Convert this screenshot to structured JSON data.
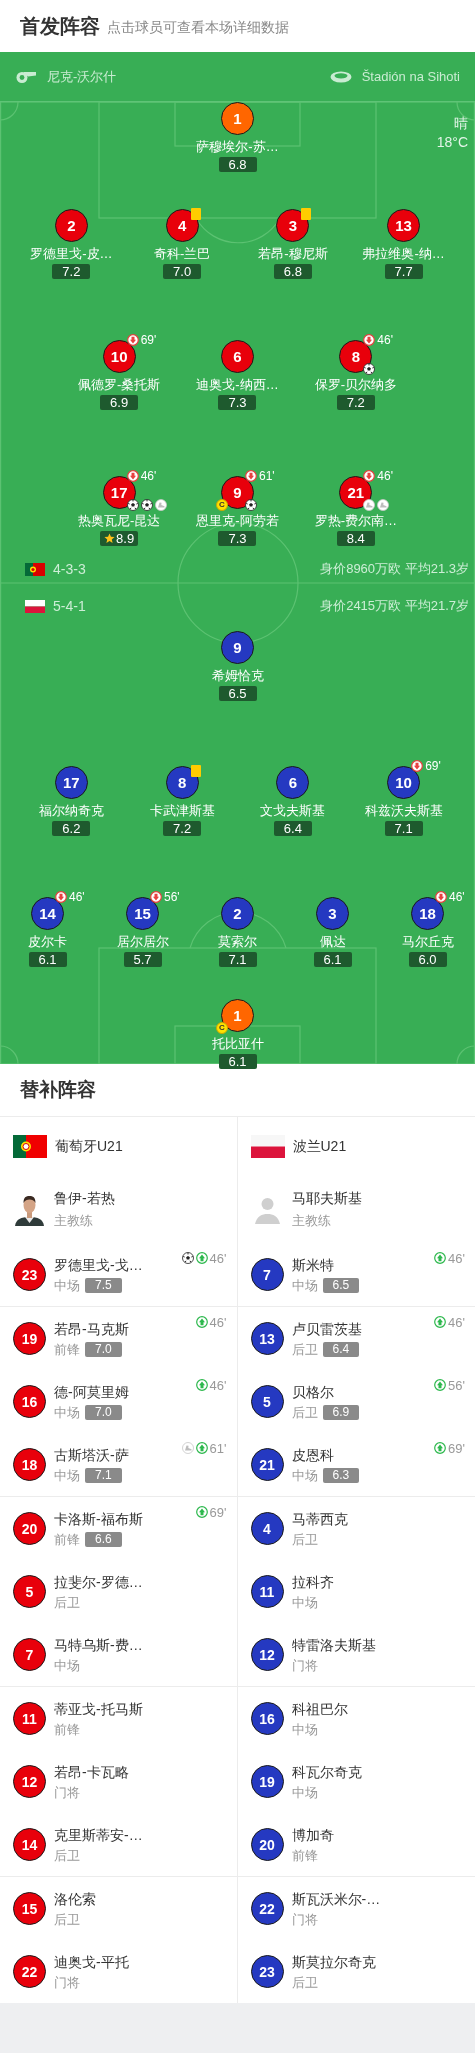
{
  "header": {
    "title": "首发阵容",
    "subtitle": "点击球员可查看本场详细数据"
  },
  "pitch": {
    "referee": "尼克-沃尔什",
    "stadium": "Štadión na Sihoti",
    "weather": "晴",
    "temperature": "18°C",
    "home": {
      "flag": {
        "kind": "portugal"
      },
      "formation": "4-3-3",
      "value_info": "身价8960万欧 平均21.3岁",
      "rows": [
        {
          "players": [
            {
              "number": "1",
              "name": "萨穆埃尔-苏…",
              "rating": "6.8",
              "color": "#ff6600",
              "yellow_card": false,
              "top_rated": false
            }
          ]
        },
        {
          "players": [
            {
              "number": "2",
              "name": "罗德里戈-皮…",
              "rating": "7.2",
              "color": "#e8000b",
              "yellow_card": false,
              "top_rated": false
            },
            {
              "number": "4",
              "name": "奇科-兰巴",
              "rating": "7.0",
              "color": "#e8000b",
              "yellow_card": true,
              "top_rated": false
            },
            {
              "number": "3",
              "name": "若昂-穆尼斯",
              "rating": "6.8",
              "color": "#e8000b",
              "yellow_card": true,
              "top_rated": false
            },
            {
              "number": "13",
              "name": "弗拉维奥-纳…",
              "rating": "7.7",
              "color": "#e8000b",
              "yellow_card": false,
              "top_rated": false
            }
          ]
        },
        {
          "players": [
            {
              "number": "10",
              "name": "佩德罗-桑托斯",
              "rating": "6.9",
              "color": "#e8000b",
              "yellow_card": false,
              "top_rated": false,
              "sub_out": "69'"
            },
            {
              "number": "6",
              "name": "迪奥戈-纳西…",
              "rating": "7.3",
              "color": "#e8000b",
              "yellow_card": false,
              "top_rated": false
            },
            {
              "number": "8",
              "name": "保罗-贝尔纳多",
              "rating": "7.2",
              "color": "#e8000b",
              "yellow_card": false,
              "top_rated": false,
              "sub_out": "46'",
              "events": [
                {
                  "kind": "goal"
                }
              ]
            }
          ]
        },
        {
          "players": [
            {
              "number": "17",
              "name": "热奥瓦尼-昆达",
              "rating": "8.9",
              "color": "#e8000b",
              "yellow_card": false,
              "top_rated": true,
              "sub_out": "46'",
              "events": [
                {
                  "kind": "goal"
                },
                {
                  "kind": "goal"
                },
                {
                  "kind": "assist"
                }
              ]
            },
            {
              "number": "9",
              "name": "恩里克-阿劳若",
              "rating": "7.3",
              "color": "#e8000b",
              "yellow_card": false,
              "top_rated": false,
              "captain_badge": "C",
              "sub_out": "61'",
              "events": [
                {
                  "kind": "goal"
                }
              ]
            },
            {
              "number": "21",
              "name": "罗热-费尔南…",
              "rating": "8.4",
              "color": "#e8000b",
              "yellow_card": false,
              "top_rated": false,
              "sub_out": "46'",
              "events": [
                {
                  "kind": "assist"
                },
                {
                  "kind": "assist"
                }
              ]
            }
          ]
        }
      ]
    },
    "away": {
      "flag": {
        "kind": "poland"
      },
      "formation": "5-4-1",
      "value_info": "身价2415万欧 平均21.7岁",
      "rows": [
        {
          "players": [
            {
              "number": "9",
              "name": "希姆恰克",
              "rating": "6.5",
              "color": "#2539c1",
              "yellow_card": false,
              "top_rated": false
            }
          ]
        },
        {
          "players": [
            {
              "number": "17",
              "name": "福尔纳奇克",
              "rating": "6.2",
              "color": "#2539c1",
              "yellow_card": false,
              "top_rated": false
            },
            {
              "number": "8",
              "name": "卡武津斯基",
              "rating": "7.2",
              "color": "#2539c1",
              "yellow_card": true,
              "top_rated": false
            },
            {
              "number": "6",
              "name": "文戈夫斯基",
              "rating": "6.4",
              "color": "#2539c1",
              "yellow_card": false,
              "top_rated": false
            },
            {
              "number": "10",
              "name": "科兹沃夫斯基",
              "rating": "7.1",
              "color": "#2539c1",
              "yellow_card": false,
              "top_rated": false,
              "sub_out": "69'"
            }
          ]
        },
        {
          "players": [
            {
              "number": "14",
              "name": "皮尔卡",
              "rating": "6.1",
              "color": "#2539c1",
              "yellow_card": false,
              "top_rated": false,
              "sub_out": "46'"
            },
            {
              "number": "15",
              "name": "居尔居尔",
              "rating": "5.7",
              "color": "#2539c1",
              "yellow_card": false,
              "top_rated": false,
              "sub_out": "56'"
            },
            {
              "number": "2",
              "name": "莫索尔",
              "rating": "7.1",
              "color": "#2539c1",
              "yellow_card": false,
              "top_rated": false
            },
            {
              "number": "3",
              "name": "佩达",
              "rating": "6.1",
              "color": "#2539c1",
              "yellow_card": false,
              "top_rated": false
            },
            {
              "number": "18",
              "name": "马尔丘克",
              "rating": "6.0",
              "color": "#2539c1",
              "yellow_card": false,
              "top_rated": false,
              "sub_out": "46'"
            }
          ]
        },
        {
          "players": [
            {
              "number": "1",
              "name": "托比亚什",
              "rating": "6.1",
              "color": "#ff6600",
              "yellow_card": false,
              "top_rated": false,
              "captain_badge": "C"
            }
          ]
        }
      ]
    }
  },
  "subs": {
    "title": "替补阵容",
    "home": {
      "name": "葡萄牙U21",
      "flag": {
        "kind": "portugal"
      },
      "coach": {
        "name": "鲁伊-若热",
        "role": "主教练",
        "photo": true
      },
      "players": [
        {
          "number": "23",
          "name": "罗德里戈-戈…",
          "position": "中场",
          "rating": "7.5",
          "sub_in": "46'",
          "events": [
            {
              "kind": "goal"
            }
          ],
          "color": "#e8000b"
        },
        {
          "number": "19",
          "name": "若昂-马克斯",
          "position": "前锋",
          "rating": "7.0",
          "sub_in": "46'",
          "color": "#e8000b"
        },
        {
          "number": "16",
          "name": "德-阿莫里姆",
          "position": "中场",
          "rating": "7.0",
          "sub_in": "46'",
          "color": "#e8000b"
        },
        {
          "number": "18",
          "name": "古斯塔沃-萨",
          "position": "中场",
          "rating": "7.1",
          "sub_in": "61'",
          "events": [
            {
              "kind": "assist"
            }
          ],
          "color": "#e8000b"
        },
        {
          "number": "20",
          "name": "卡洛斯-福布斯",
          "position": "前锋",
          "rating": "6.6",
          "sub_in": "69'",
          "color": "#e8000b"
        },
        {
          "number": "5",
          "name": "拉斐尔-罗德…",
          "position": "后卫",
          "color": "#e8000b"
        },
        {
          "number": "7",
          "name": "马特乌斯-费…",
          "position": "中场",
          "color": "#e8000b"
        },
        {
          "number": "11",
          "name": "蒂亚戈-托马斯",
          "position": "前锋",
          "color": "#e8000b"
        },
        {
          "number": "12",
          "name": "若昂-卡瓦略",
          "position": "门将",
          "color": "#e8000b"
        },
        {
          "number": "14",
          "name": "克里斯蒂安-…",
          "position": "后卫",
          "color": "#e8000b"
        },
        {
          "number": "15",
          "name": "洛伦索",
          "position": "后卫",
          "color": "#e8000b"
        },
        {
          "number": "22",
          "name": "迪奥戈-平托",
          "position": "门将",
          "color": "#e8000b"
        }
      ]
    },
    "away": {
      "name": "波兰U21",
      "flag": {
        "kind": "poland"
      },
      "coach": {
        "name": "马耶夫斯基",
        "role": "主教练",
        "photo": false
      },
      "players": [
        {
          "number": "7",
          "name": "斯米特",
          "position": "中场",
          "rating": "6.5",
          "sub_in": "46'",
          "color": "#2539c1"
        },
        {
          "number": "13",
          "name": "卢贝雷茨基",
          "position": "后卫",
          "rating": "6.4",
          "sub_in": "46'",
          "color": "#2539c1"
        },
        {
          "number": "5",
          "name": "贝格尔",
          "position": "后卫",
          "rating": "6.9",
          "sub_in": "56'",
          "color": "#2539c1"
        },
        {
          "number": "21",
          "name": "皮恩科",
          "position": "中场",
          "rating": "6.3",
          "sub_in": "69'",
          "color": "#2539c1"
        },
        {
          "number": "4",
          "name": "马蒂西克",
          "position": "后卫",
          "color": "#2539c1"
        },
        {
          "number": "11",
          "name": "拉科齐",
          "position": "中场",
          "color": "#2539c1"
        },
        {
          "number": "12",
          "name": "特雷洛夫斯基",
          "position": "门将",
          "color": "#2539c1"
        },
        {
          "number": "16",
          "name": "科祖巴尔",
          "position": "中场",
          "color": "#2539c1"
        },
        {
          "number": "19",
          "name": "科瓦尔奇克",
          "position": "中场",
          "color": "#2539c1"
        },
        {
          "number": "20",
          "name": "博加奇",
          "position": "前锋",
          "color": "#2539c1"
        },
        {
          "number": "22",
          "name": "斯瓦沃米尔-…",
          "position": "门将",
          "color": "#2539c1"
        },
        {
          "number": "23",
          "name": "斯莫拉尔奇克",
          "position": "后卫",
          "color": "#2539c1"
        }
      ]
    }
  }
}
